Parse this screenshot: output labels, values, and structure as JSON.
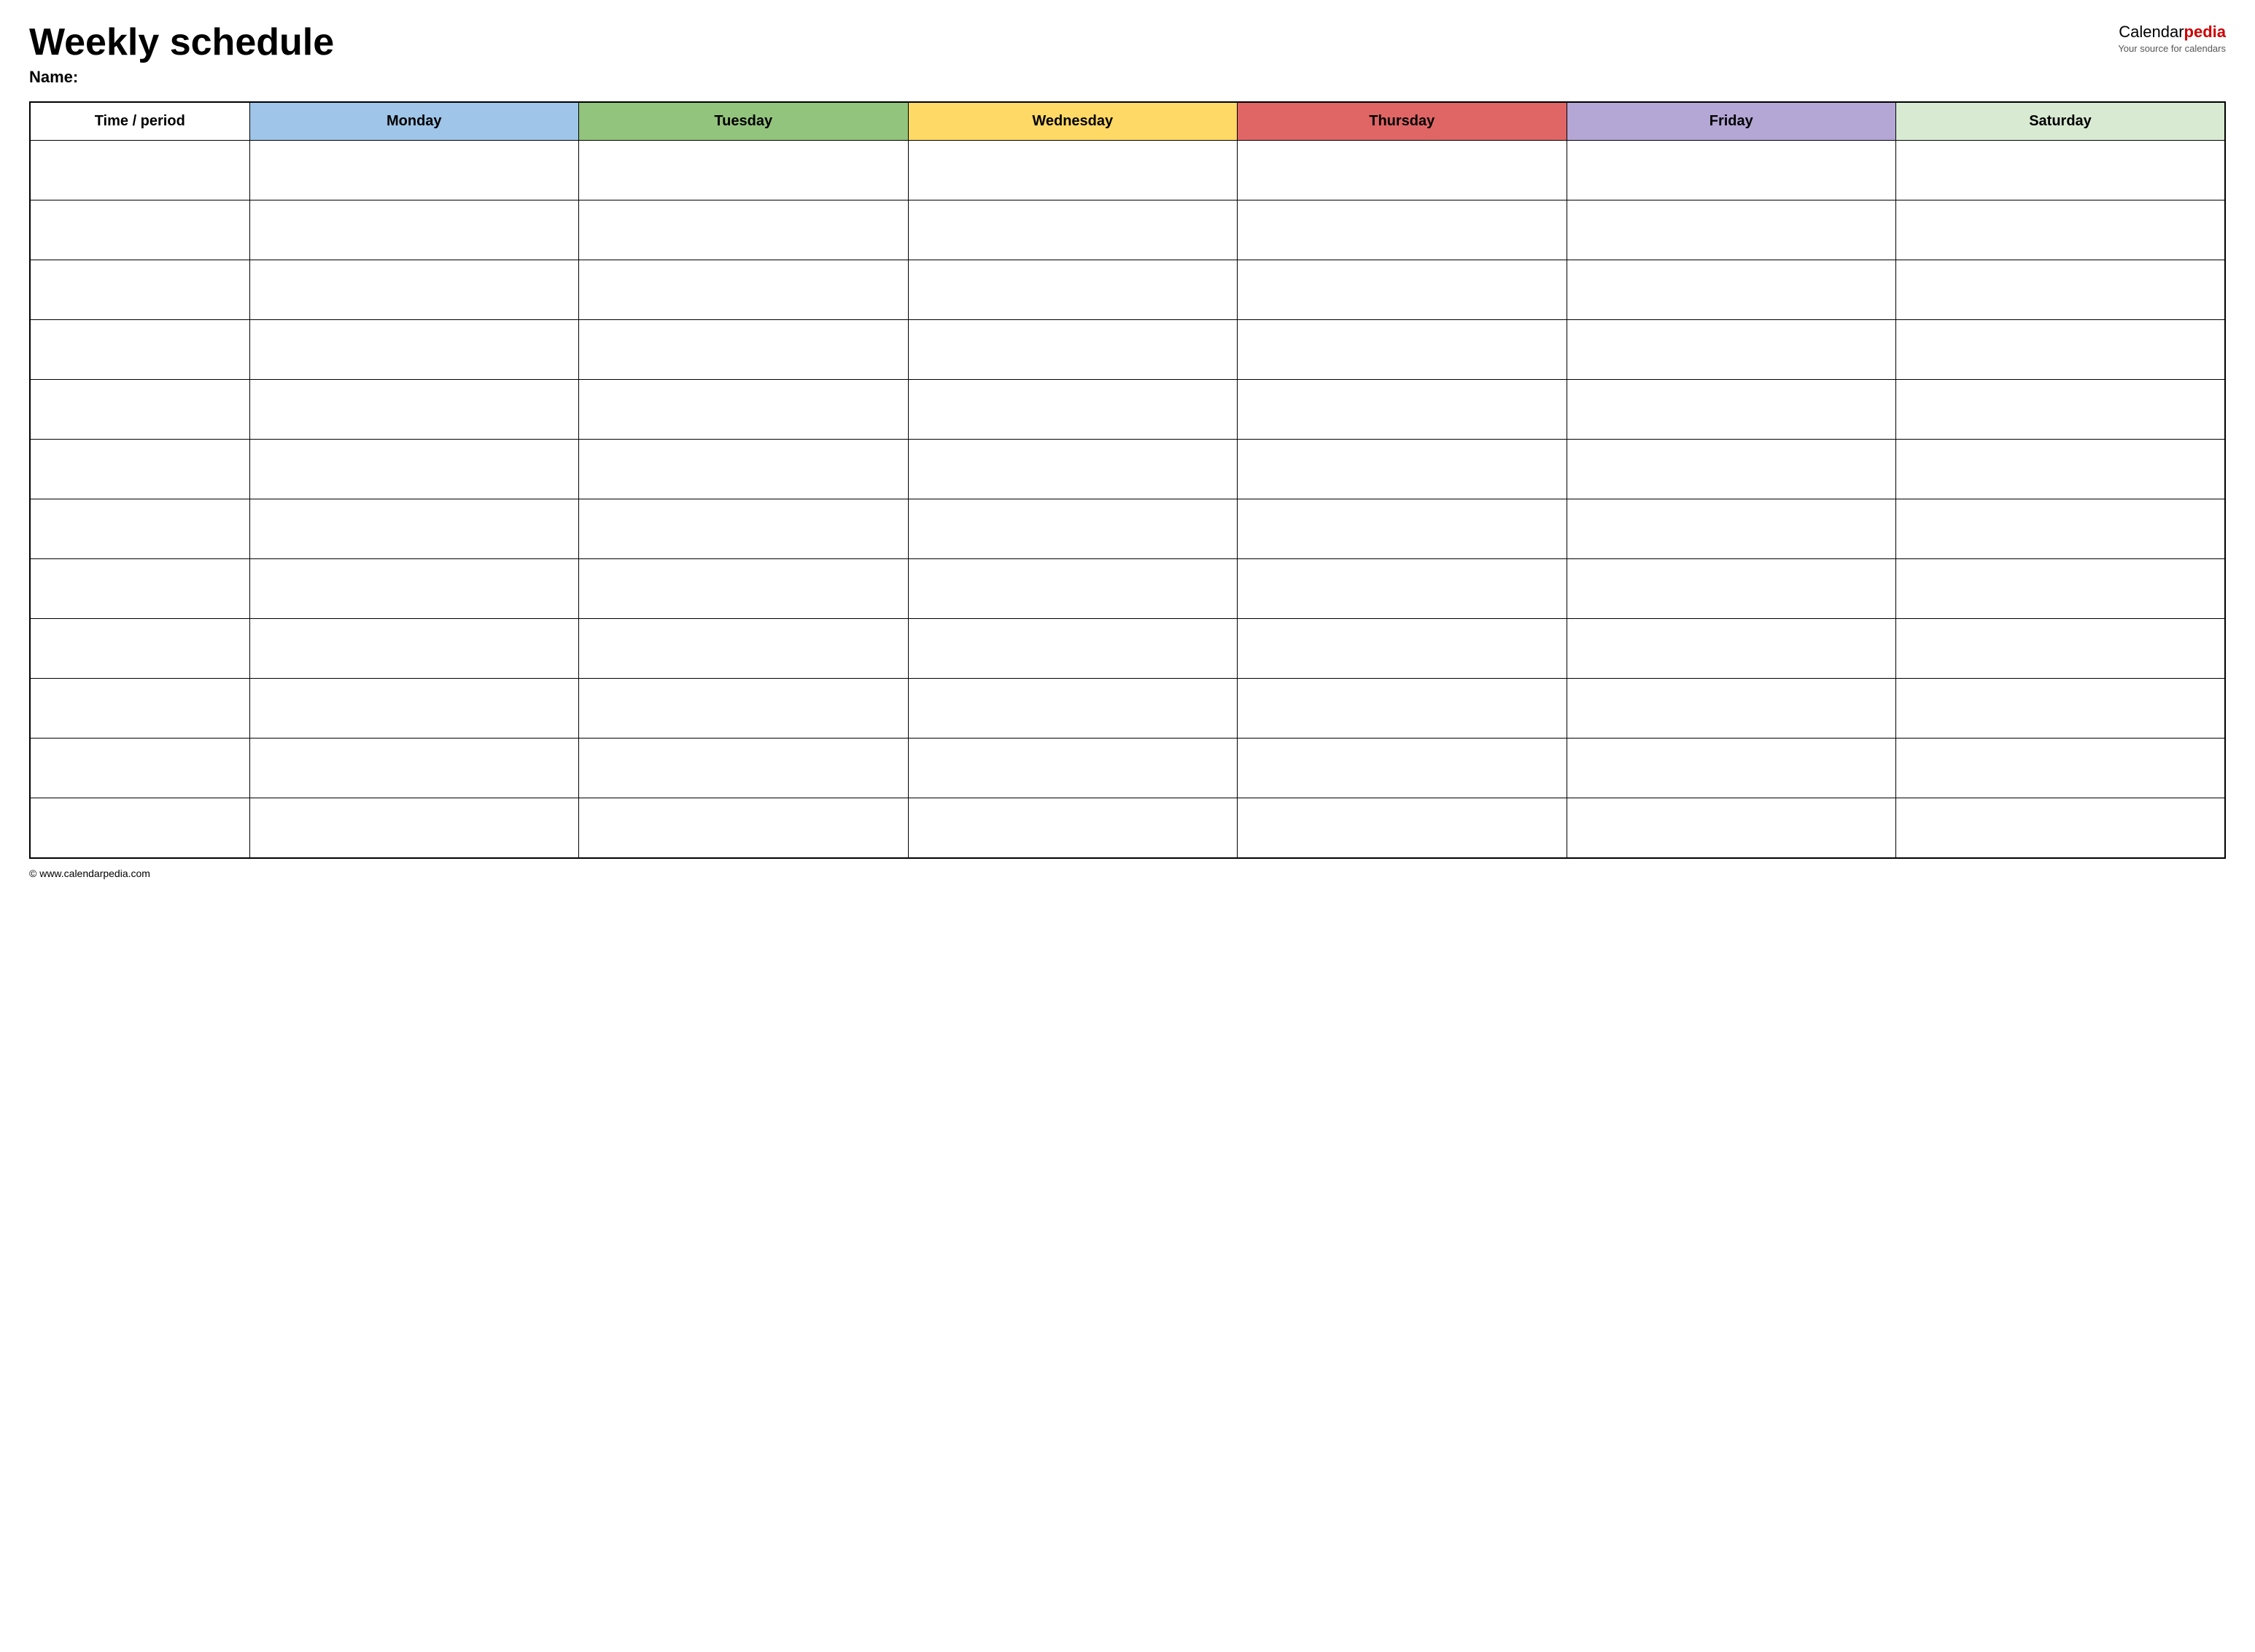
{
  "header": {
    "title": "Weekly schedule",
    "name_label": "Name:",
    "logo_calendar": "Calendar",
    "logo_pedia": "pedia",
    "logo_tagline": "Your source for calendars"
  },
  "table": {
    "columns": [
      {
        "key": "time",
        "label": "Time / period",
        "color": "#ffffff"
      },
      {
        "key": "monday",
        "label": "Monday",
        "color": "#9fc5e8"
      },
      {
        "key": "tuesday",
        "label": "Tuesday",
        "color": "#93c47d"
      },
      {
        "key": "wednesday",
        "label": "Wednesday",
        "color": "#ffd966"
      },
      {
        "key": "thursday",
        "label": "Thursday",
        "color": "#e06666"
      },
      {
        "key": "friday",
        "label": "Friday",
        "color": "#b4a7d6"
      },
      {
        "key": "saturday",
        "label": "Saturday",
        "color": "#d9ead3"
      }
    ],
    "row_count": 12
  },
  "footer": {
    "url": "© www.calendarpedia.com"
  }
}
